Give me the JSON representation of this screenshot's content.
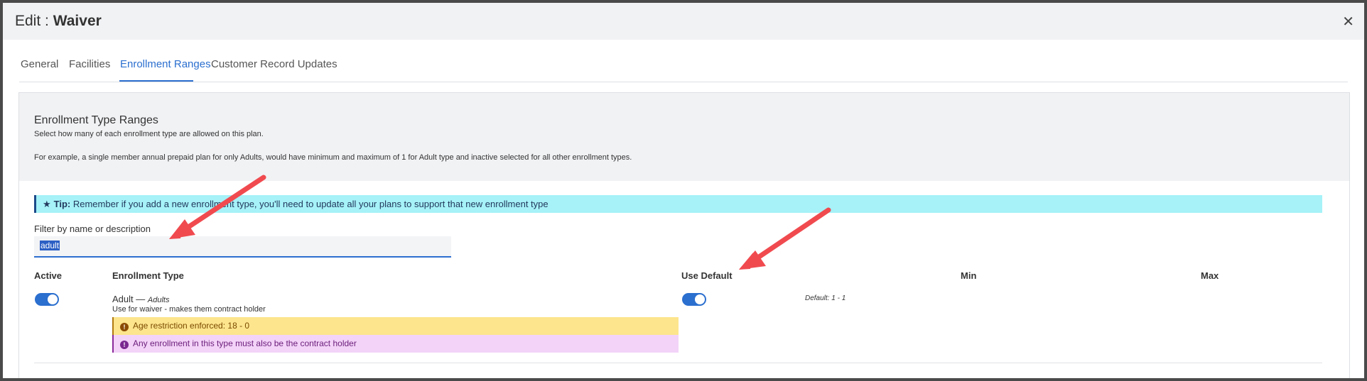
{
  "modal": {
    "title_prefix": "Edit : ",
    "title_name": "Waiver",
    "close_glyph": "✕"
  },
  "tabs": [
    {
      "label": "General",
      "active": false
    },
    {
      "label": "Facilities",
      "active": false
    },
    {
      "label": "Enrollment Ranges",
      "active": true
    },
    {
      "label": "Customer Record Updates",
      "active": false
    }
  ],
  "panel": {
    "title": "Enrollment Type Ranges",
    "description": "Select how many of each enrollment type are allowed on this plan.",
    "example": "For example, a single member annual prepaid plan for only Adults, would have minimum and maximum of 1 for Adult type and inactive selected for all other enrollment types."
  },
  "tip": {
    "icon": "star-icon",
    "label": "Tip:",
    "text": " Remember if you add a new enrollment type, you'll need to update all your plans to support that new enrollment type"
  },
  "filter": {
    "label": "Filter by name or description",
    "value": "adult"
  },
  "table": {
    "headers": {
      "active": "Active",
      "type": "Enrollment Type",
      "use_default": "Use Default",
      "min": "Min",
      "max": "Max"
    },
    "rows": [
      {
        "active": true,
        "name": "Adult",
        "separator": " — ",
        "plural": "Adults",
        "description": "Use for waiver - makes them contract holder",
        "warning": "Age restriction enforced: 18 - 0",
        "info": "Any enrollment in this type must also be the contract holder",
        "use_default": true,
        "default_text": "Default: 1 - 1"
      }
    ]
  },
  "colors": {
    "accent": "#2b6fcf",
    "tip_bg": "#a6f2f8",
    "warning_bg": "#fde58d",
    "info_bg": "#f3d3f8",
    "annotation_arrow": "#f04a4f"
  }
}
